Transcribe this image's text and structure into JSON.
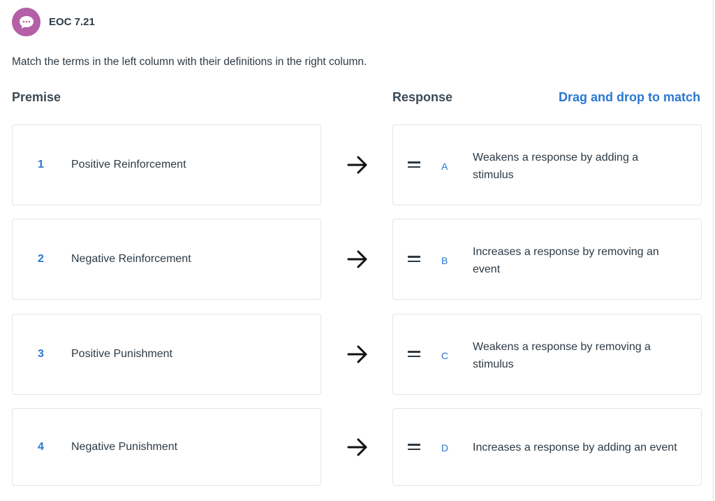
{
  "header": {
    "title": "EOC 7.21",
    "icon": "chat-bubble-icon",
    "badge_color": "#b45fa6"
  },
  "instructions": "Match the terms in the left column with their definitions in the right column.",
  "columns": {
    "premise": "Premise",
    "response": "Response",
    "hint": "Drag and drop to match"
  },
  "colors": {
    "accent": "#2a78d0",
    "text": "#2d3a45"
  },
  "premises": [
    {
      "number": "1",
      "label": "Positive Reinforcement"
    },
    {
      "number": "2",
      "label": "Negative Reinforcement"
    },
    {
      "number": "3",
      "label": "Positive Punishment"
    },
    {
      "number": "4",
      "label": "Negative Punishment"
    }
  ],
  "responses": [
    {
      "letter": "A",
      "text": "Weakens a response by adding a stimulus"
    },
    {
      "letter": "B",
      "text": "Increases a response by removing an event"
    },
    {
      "letter": "C",
      "text": "Weakens a response by removing a stimulus"
    },
    {
      "letter": "D",
      "text": "Increases a response by adding an event"
    }
  ]
}
